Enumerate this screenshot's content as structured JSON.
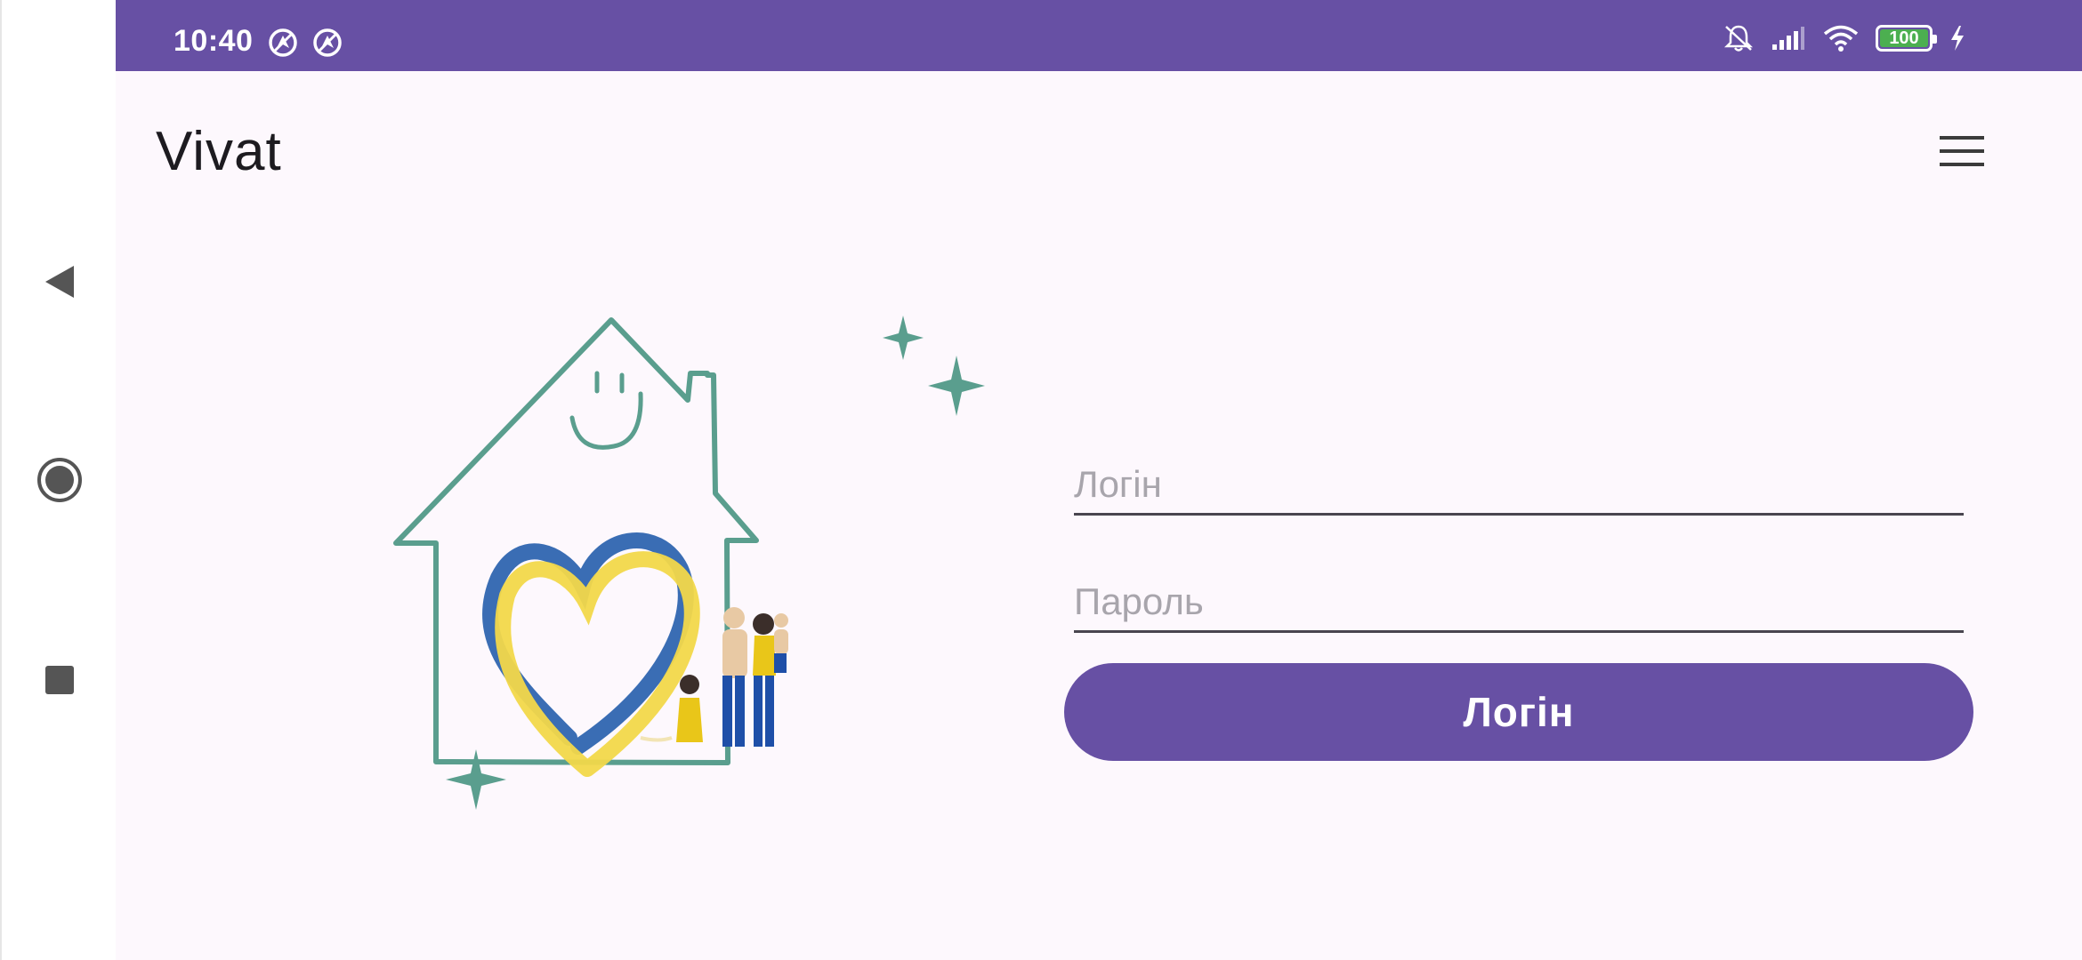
{
  "status_bar": {
    "time": "10:40",
    "battery_level": "100",
    "battery_fill_fraction": 1.0,
    "icons": [
      "location-off-icon",
      "location-off-icon",
      "silent-icon",
      "signal-icon",
      "wifi-icon",
      "battery-icon",
      "charging-icon"
    ]
  },
  "app_bar": {
    "title": "Vivat",
    "menu_icon": "hamburger-menu-icon"
  },
  "navigation": {
    "back_icon": "back-triangle-icon",
    "home_icon": "home-circle-icon",
    "recents_icon": "recents-square-icon"
  },
  "login_form": {
    "login_placeholder": "Логін",
    "login_value": "",
    "password_placeholder": "Пароль",
    "password_value": "",
    "submit_label": "Логін"
  },
  "colors": {
    "primary": "#6750a4",
    "background": "#fdf8fd",
    "house_stroke": "#5a9e8e",
    "ukraine_blue": "#3a6db4",
    "ukraine_yellow": "#f2d84a"
  }
}
